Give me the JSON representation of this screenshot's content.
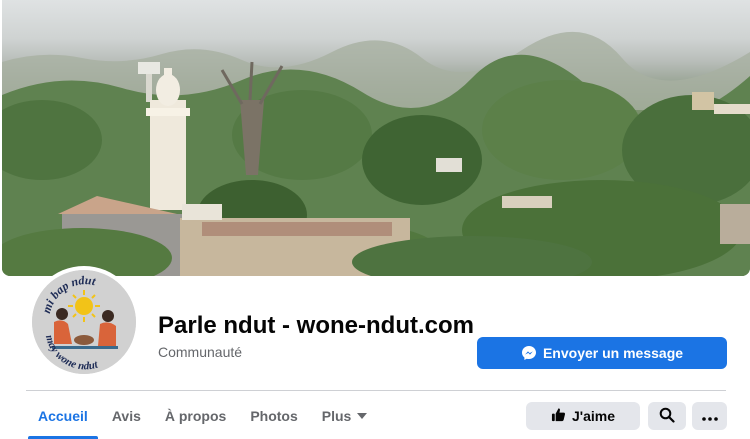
{
  "page": {
    "title": "Parle ndut - wone-ndut.com",
    "category": "Communauté"
  },
  "cover": {
    "description_icon": "cover-photo"
  },
  "avatar": {
    "logo_top_text": "mi bap ndut",
    "logo_bottom_text": "may wone ndut"
  },
  "actions": {
    "message_label": "Envoyer un message",
    "message_icon": "messenger-icon",
    "like_label": "J'aime",
    "like_icon": "thumbs-up-icon",
    "search_icon": "search-icon",
    "more_icon": "more-icon"
  },
  "tabs": [
    {
      "label": "Accueil",
      "active": true
    },
    {
      "label": "Avis",
      "active": false
    },
    {
      "label": "À propos",
      "active": false
    },
    {
      "label": "Photos",
      "active": false
    },
    {
      "label": "Plus",
      "active": false
    }
  ],
  "colors": {
    "accent": "#1b74e4",
    "secondary_text": "#65676b",
    "button_grey": "#e4e6eb"
  }
}
